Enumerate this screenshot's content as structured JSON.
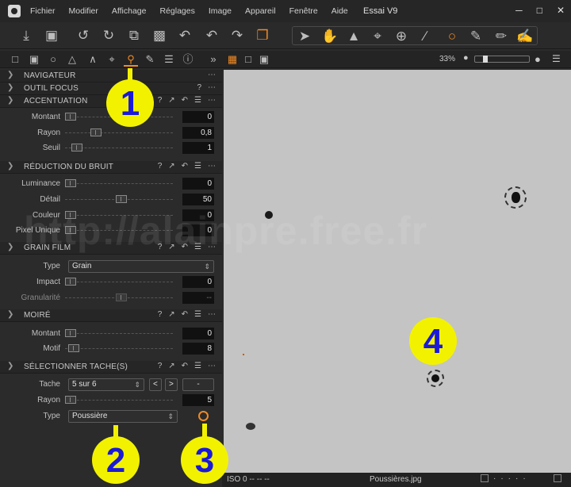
{
  "window": {
    "title": "Essai V9"
  },
  "menu": [
    "Fichier",
    "Modifier",
    "Affichage",
    "Réglages",
    "Image",
    "Appareil",
    "Fenêtre",
    "Aide"
  ],
  "viewer": {
    "zoom": "33%"
  },
  "sections": {
    "navigateur": "NAVIGATEUR",
    "outil_focus": "OUTIL FOCUS",
    "accentuation": {
      "title": "ACCENTUATION",
      "montant_label": "Montant",
      "montant": "0",
      "rayon_label": "Rayon",
      "rayon": "0,8",
      "seuil_label": "Seuil",
      "seuil": "1"
    },
    "bruit": {
      "title": "RÉDUCTION DU BRUIT",
      "luminance_label": "Luminance",
      "luminance": "0",
      "detail_label": "Détail",
      "detail": "50",
      "couleur_label": "Couleur",
      "couleur": "0",
      "pixel_label": "Pixel Unique",
      "pixel": "0"
    },
    "grain": {
      "title": "GRAIN FILM",
      "type_label": "Type",
      "type": "Grain",
      "impact_label": "Impact",
      "impact": "0",
      "granularite_label": "Granularité",
      "granularite": "--"
    },
    "moire": {
      "title": "MOIRÉ",
      "montant_label": "Montant",
      "montant": "0",
      "motif_label": "Motif",
      "motif": "8"
    },
    "tache": {
      "title": "SÉLECTIONNER TACHE(S)",
      "tache_label": "Tache",
      "tache": "5 sur 6",
      "prev": "<",
      "next": ">",
      "minus": "-",
      "rayon_label": "Rayon",
      "rayon": "5",
      "type_label": "Type",
      "type": "Poussière"
    }
  },
  "status": {
    "iso": "ISO 0 -- -- --",
    "filename": "Poussières.jpg"
  },
  "badges": [
    "1",
    "2",
    "3",
    "4"
  ],
  "watermark": "http://alainpre.free.fr",
  "colors": {
    "accent": "#f08a24",
    "badge": "#f2f200",
    "badge_text": "#1a1ad8"
  }
}
